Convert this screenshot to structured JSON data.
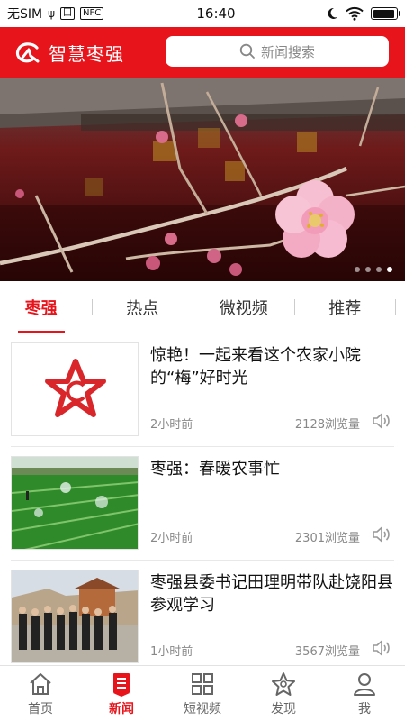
{
  "status_bar": {
    "carrier": "无SIM",
    "time": "16:40",
    "mini_icon_1": "ψ",
    "mini_icon_2": "囗",
    "mini_icon_3": "NFC",
    "battery_level": 0.92
  },
  "header": {
    "app_name": "智慧枣强",
    "search_placeholder": "新闻搜索",
    "accent": "#e8141b"
  },
  "banner": {
    "slide_count": 4,
    "active_index": 3
  },
  "tabs": [
    {
      "label": "枣强",
      "active": true
    },
    {
      "label": "热点",
      "active": false
    },
    {
      "label": "微视频",
      "active": false
    },
    {
      "label": "推荐",
      "active": false
    }
  ],
  "news": [
    {
      "title": "惊艳！一起来看这个农家小院的“梅”好时光",
      "time": "2小时前",
      "views": "2128浏览量",
      "thumb": "logo"
    },
    {
      "title": "枣强：春暖农事忙",
      "time": "2小时前",
      "views": "2301浏览量",
      "thumb": "field"
    },
    {
      "title": "枣强县委书记田理明带队赴饶阳县参观学习",
      "time": "1小时前",
      "views": "3567浏览量",
      "thumb": "group"
    }
  ],
  "bottom_nav": [
    {
      "label": "首页",
      "icon": "home-icon",
      "active": false
    },
    {
      "label": "新闻",
      "icon": "news-icon",
      "active": true
    },
    {
      "label": "短视频",
      "icon": "grid-icon",
      "active": false
    },
    {
      "label": "发现",
      "icon": "discover-icon",
      "active": false
    },
    {
      "label": "我",
      "icon": "user-icon",
      "active": false
    }
  ]
}
